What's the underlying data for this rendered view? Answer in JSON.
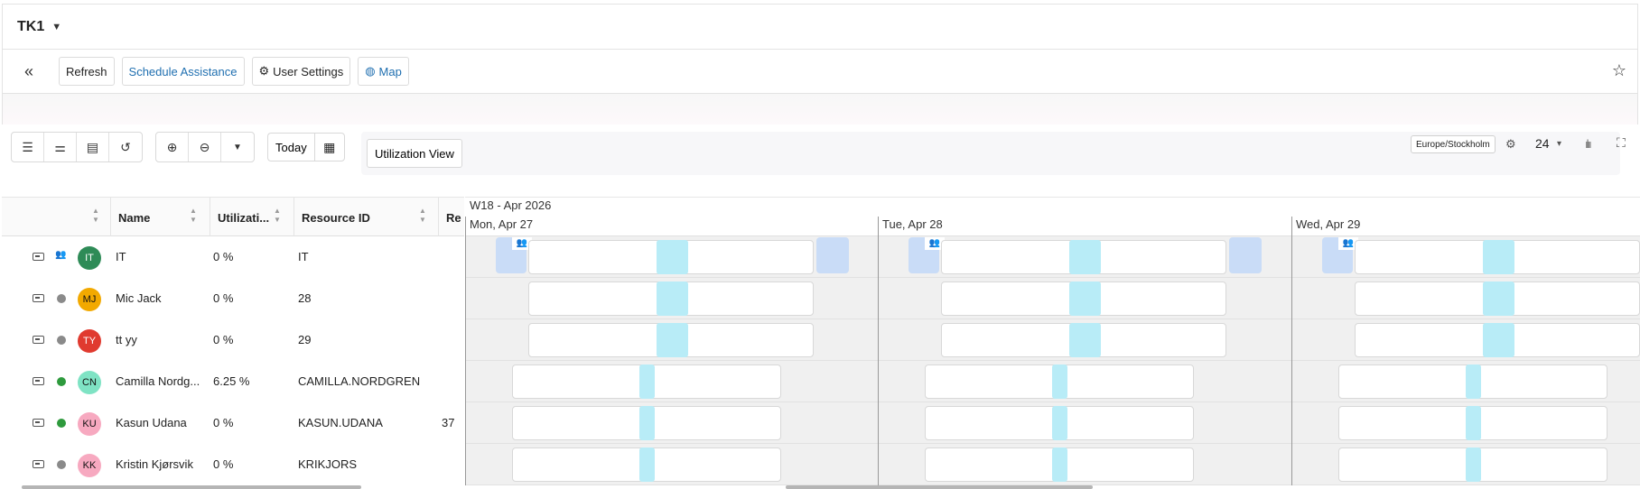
{
  "app": {
    "title": "TK1"
  },
  "toolbar": {
    "refresh": "Refresh",
    "schedule_assistance": "Schedule Assistance",
    "user_settings": "User Settings",
    "map": "Map"
  },
  "schedule": {
    "today": "Today",
    "view": "Utilization View",
    "timezone": "Europe/Stockholm",
    "hours": "24"
  },
  "columns": [
    "Name",
    "Utilizati...",
    "Resource ID",
    "Re"
  ],
  "week": "W18 - Apr 2026",
  "days": [
    "Mon, Apr 27",
    "Tue, Apr 28",
    "Wed, Apr 29"
  ],
  "rows": [
    {
      "initials": "IT",
      "name": "IT",
      "utilization": "0 %",
      "resource_id": "IT",
      "extra": "",
      "avatar_color": "#2e8b57",
      "initials_color": "#ffffff",
      "status": "group"
    },
    {
      "initials": "MJ",
      "name": "Mic Jack",
      "utilization": "0 %",
      "resource_id": "28",
      "extra": "",
      "avatar_color": "#f2a900",
      "initials_color": "#111111",
      "status": "grey"
    },
    {
      "initials": "TY",
      "name": "tt yy",
      "utilization": "0 %",
      "resource_id": "29",
      "extra": "",
      "avatar_color": "#e03a2f",
      "initials_color": "#ffffff",
      "status": "grey"
    },
    {
      "initials": "CN",
      "name": "Camilla Nordg...",
      "utilization": "6.25 %",
      "resource_id": "CAMILLA.NORDGREN",
      "extra": "",
      "avatar_color": "#7fe3c4",
      "initials_color": "#111111",
      "status": "green"
    },
    {
      "initials": "KU",
      "name": "Kasun Udana",
      "utilization": "0 %",
      "resource_id": "KASUN.UDANA",
      "extra": "37",
      "avatar_color": "#f7a9c0",
      "initials_color": "#111111",
      "status": "green"
    },
    {
      "initials": "KK",
      "name": "Kristin Kjørsvik",
      "utilization": "0 %",
      "resource_id": "KRIKJORS",
      "extra": "",
      "avatar_color": "#f7a9c0",
      "initials_color": "#111111",
      "status": "grey"
    }
  ],
  "colors": {
    "accent": "#1f6fb0",
    "status_green": "#2e9a3d",
    "status_grey": "#8a8a8a",
    "shift_fill": "#b8ecf7",
    "group_fill": "#c9dcf7"
  }
}
